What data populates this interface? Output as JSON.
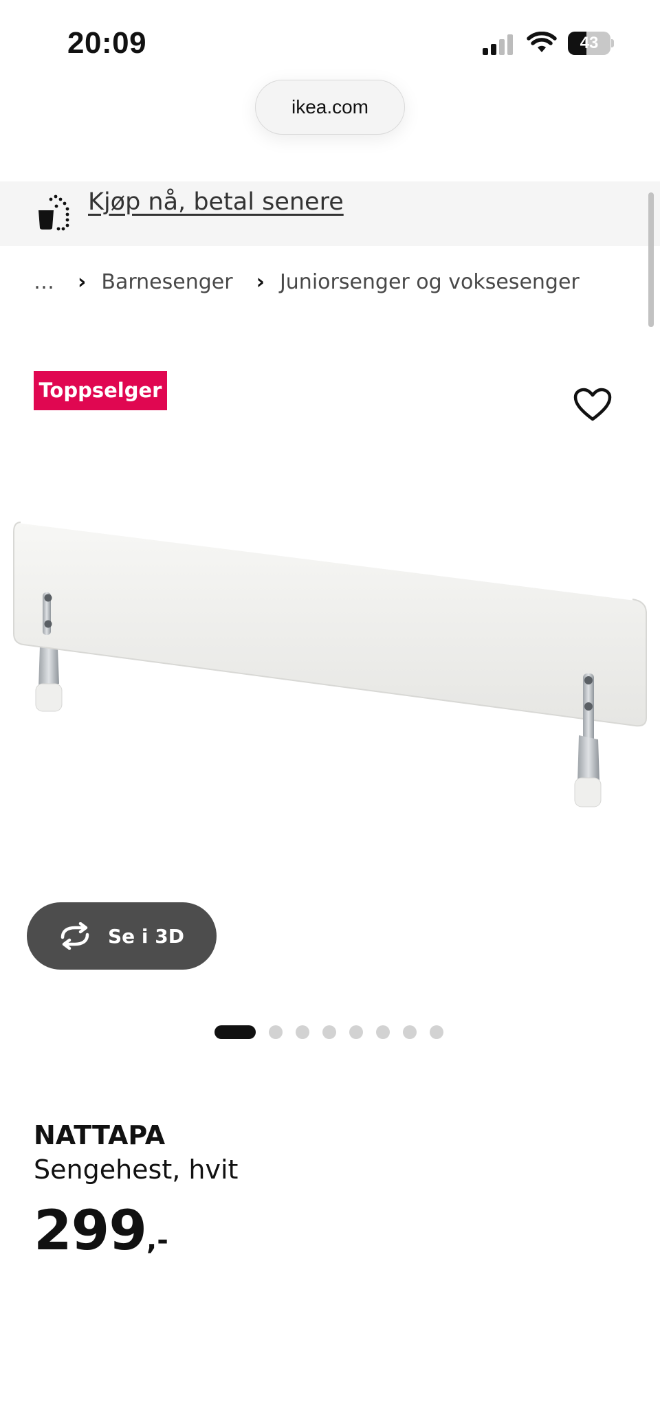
{
  "status_bar": {
    "time": "20:09",
    "battery_level": "43",
    "battery_fraction": 0.43
  },
  "browser": {
    "url": "ikea.com"
  },
  "promo": {
    "text": "Kjøp nå, betal senere",
    "icon": "installment-bag-icon"
  },
  "breadcrumb": {
    "ellipsis": "…",
    "items": [
      "Barnesenger",
      "Juniorsenger og voksesenger"
    ]
  },
  "product": {
    "badge": "Toppselger",
    "name": "NATTAPA",
    "description": "Sengehest, hvit",
    "price_integer": "299",
    "price_suffix": ",-",
    "view_3d_label": "Se i 3D",
    "gallery_count": 8,
    "gallery_active_index": 0
  },
  "colors": {
    "badge": "#e00751",
    "button_3d": "#4d4d4d",
    "text": "#111111",
    "banner_bg": "#f5f5f5"
  }
}
